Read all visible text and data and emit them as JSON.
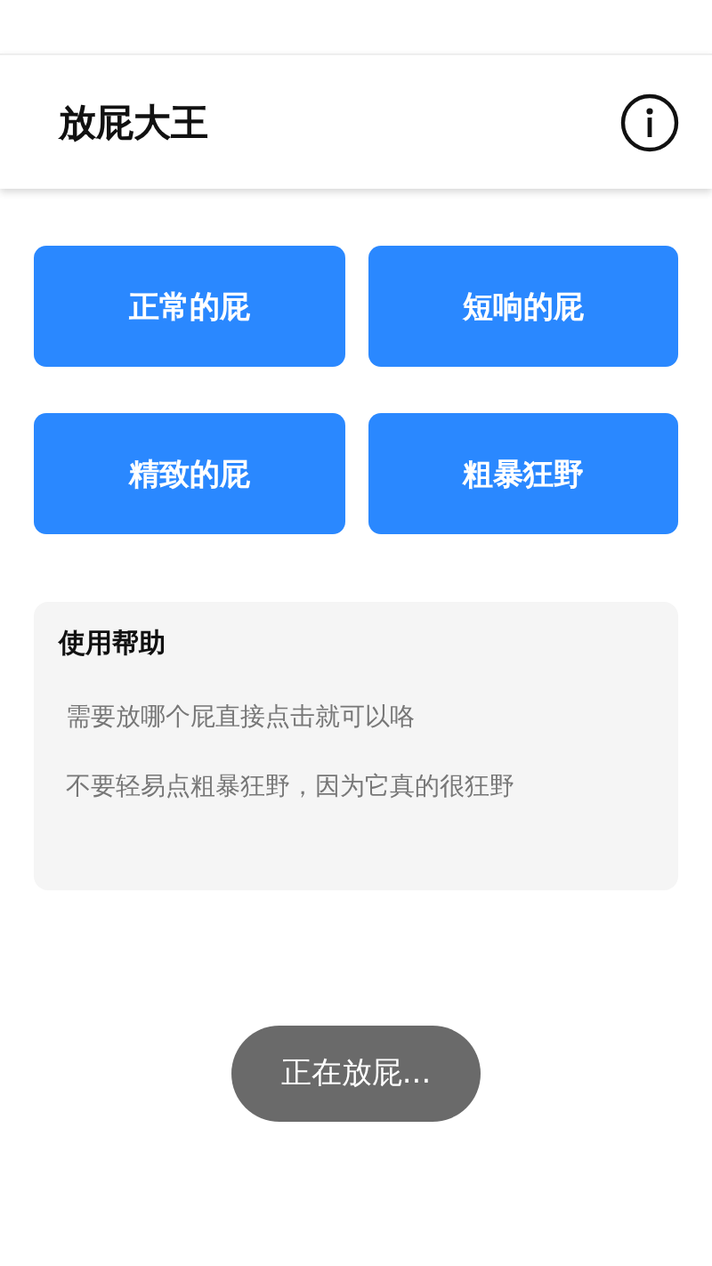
{
  "header": {
    "title": "放屁大王"
  },
  "buttons": [
    {
      "label": "正常的屁"
    },
    {
      "label": "短响的屁"
    },
    {
      "label": "精致的屁"
    },
    {
      "label": "粗暴狂野"
    }
  ],
  "help": {
    "title": "使用帮助",
    "lines": [
      "需要放哪个屁直接点击就可以咯",
      "不要轻易点粗暴狂野，因为它真的很狂野"
    ]
  },
  "toast": {
    "text": "正在放屁..."
  }
}
